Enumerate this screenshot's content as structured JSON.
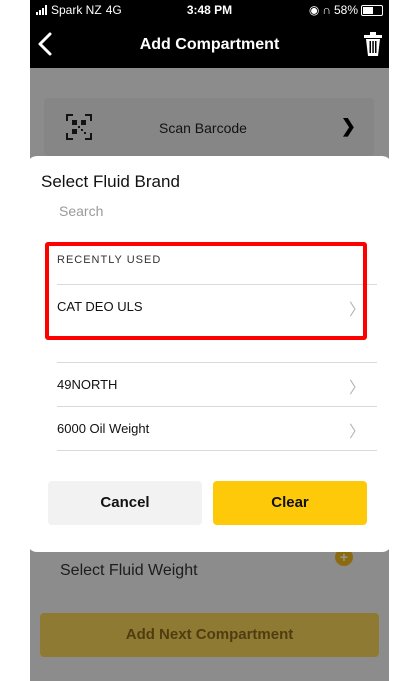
{
  "status": {
    "carrier": "Spark NZ",
    "network": "4G",
    "time": "3:48 PM",
    "battery": "58%",
    "battery_level": 0.58
  },
  "nav": {
    "title": "Add Compartment"
  },
  "page": {
    "scan_label": "Scan Barcode",
    "fluid_weight_placeholder": "Select Fluid Weight",
    "add_next_label": "Add Next Compartment"
  },
  "dialog": {
    "title": "Select Fluid Brand",
    "search_placeholder": "Search",
    "recent_header": "RECENTLY USED",
    "recent_items": [
      "CAT DEO ULS"
    ],
    "items": [
      "49NORTH",
      "6000 Oil Weight"
    ],
    "cancel_label": "Cancel",
    "clear_label": "Clear"
  },
  "colors": {
    "accent": "#fdc908",
    "highlight": "#ff0000",
    "navbar": "#000000"
  },
  "icons": {
    "back": "chevron-left-icon",
    "delete": "trash-icon",
    "scan": "qr-code-icon",
    "row": "chevron-right-icon"
  }
}
